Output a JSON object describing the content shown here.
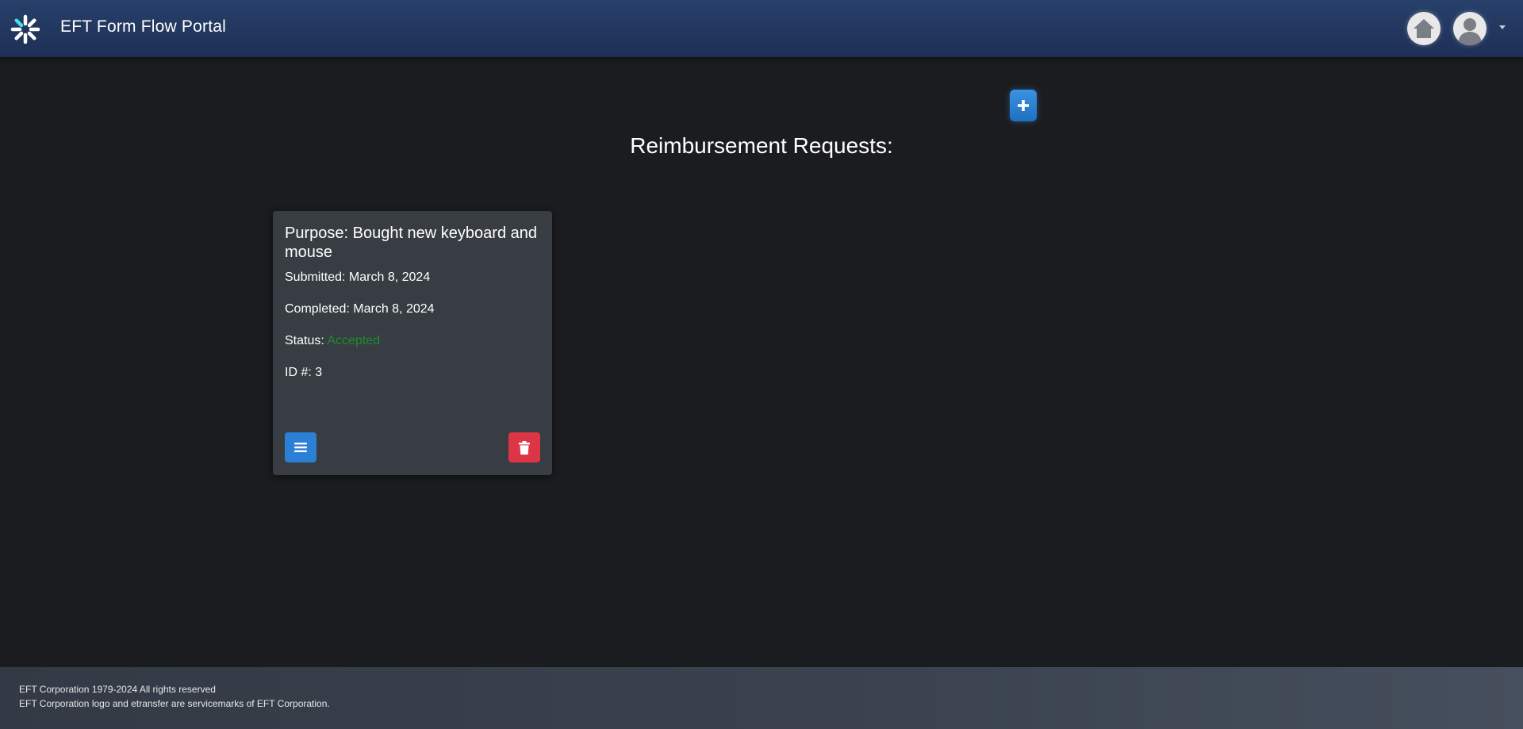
{
  "header": {
    "title": "EFT Form Flow Portal",
    "logo_icon": "asterisk-logo-icon",
    "home_icon": "home-icon",
    "avatar_icon": "user-avatar-icon",
    "menu_icon": "caret-down-icon"
  },
  "main": {
    "add_icon": "plus-icon",
    "title": "Reimbursement Requests:",
    "requests": [
      {
        "purpose": "Purpose: Bought new keyboard and mouse",
        "submitted": "Submitted: March 8, 2024",
        "completed": "Completed: March 8, 2024",
        "status_label": "Status:",
        "status_value": "Accepted",
        "id": "ID #: 3",
        "details_icon": "list-icon",
        "delete_icon": "trash-icon"
      }
    ]
  },
  "footer": {
    "line1": "EFT Corporation 1979-2024 All rights reserved",
    "line2": "EFT Corporation logo and etransfer are servicemarks of EFT Corporation."
  },
  "colors": {
    "header_bg": "#27406a",
    "page_bg": "#1b1c1f",
    "card_bg": "#383c43",
    "primary_blue": "#2b7fd4",
    "danger_red": "#dc3545",
    "status_accepted": "#1f8e2c"
  }
}
